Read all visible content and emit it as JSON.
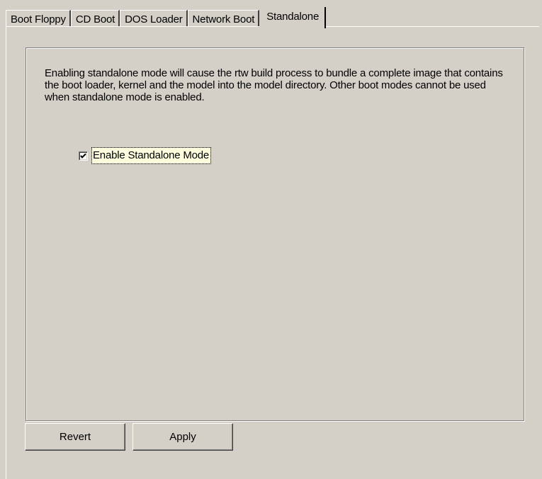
{
  "tabs": [
    {
      "label": "Boot Floppy",
      "active": false
    },
    {
      "label": "CD Boot",
      "active": false
    },
    {
      "label": "DOS Loader",
      "active": false
    },
    {
      "label": "Network Boot",
      "active": false
    },
    {
      "label": "Standalone",
      "active": true
    }
  ],
  "panel": {
    "description": "Enabling standalone mode will cause the rtw build process to bundle a complete image that contains the boot loader, kernel and the model into the model directory. Other boot modes cannot be used when standalone mode is enabled.",
    "checkbox": {
      "label": "Enable Standalone Mode",
      "checked": true
    }
  },
  "buttons": {
    "revert_label": "Revert",
    "apply_label": "Apply"
  },
  "colors": {
    "face": "#d4d0c8",
    "highlight": "#ffffff",
    "shadow": "#808080",
    "dark_shadow": "#404040",
    "focus_background": "#ffffe0"
  }
}
